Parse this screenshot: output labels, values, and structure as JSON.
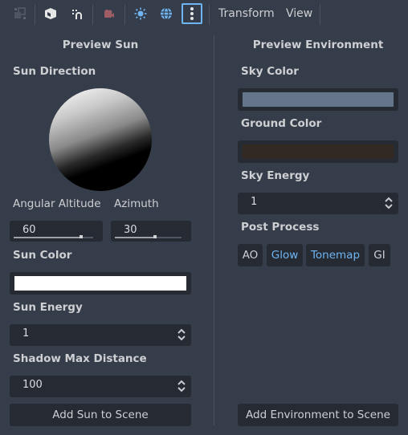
{
  "toolbar": {
    "icons": [
      {
        "name": "grid-snap-icon",
        "color": "#5c6270"
      },
      {
        "name": "cube-icon",
        "color": "#e0e0e0"
      },
      {
        "name": "magnet-icon",
        "color": "#e0e0e0"
      },
      {
        "name": "camera-icon",
        "color": "#a15d66"
      },
      {
        "name": "sun-icon",
        "color": "#6fb5f2"
      },
      {
        "name": "globe-icon",
        "color": "#6fb5f2"
      },
      {
        "name": "more-options-icon",
        "color": "#e0e0e0"
      }
    ],
    "menus": {
      "transform": "Transform",
      "view": "View"
    }
  },
  "preview_sun": {
    "title": "Preview Sun",
    "sun_direction_label": "Sun Direction",
    "angular_altitude_label": "Angular Altitude",
    "azimuth_label": "Azimuth",
    "angular_altitude_value": "60",
    "angular_altitude_fraction": 0.85,
    "azimuth_value": "30",
    "azimuth_fraction": 0.6,
    "sun_color_label": "Sun Color",
    "sun_color": "#ffffff",
    "sun_energy_label": "Sun Energy",
    "sun_energy_value": "1",
    "shadow_max_distance_label": "Shadow Max Distance",
    "shadow_max_distance_value": "100",
    "add_button": "Add Sun to Scene"
  },
  "preview_environment": {
    "title": "Preview Environment",
    "sky_color_label": "Sky Color",
    "sky_color": "#647489",
    "ground_color_label": "Ground Color",
    "ground_color": "#322a22",
    "sky_energy_label": "Sky Energy",
    "sky_energy_value": "1",
    "post_process_label": "Post Process",
    "toggles": [
      {
        "label": "AO",
        "on": false
      },
      {
        "label": "Glow",
        "on": true
      },
      {
        "label": "Tonemap",
        "on": true
      },
      {
        "label": "GI",
        "on": false
      }
    ],
    "add_button": "Add Environment to Scene"
  },
  "colors": {
    "accent": "#6fb5f2",
    "background": "#363d4a",
    "field": "#252a33"
  }
}
